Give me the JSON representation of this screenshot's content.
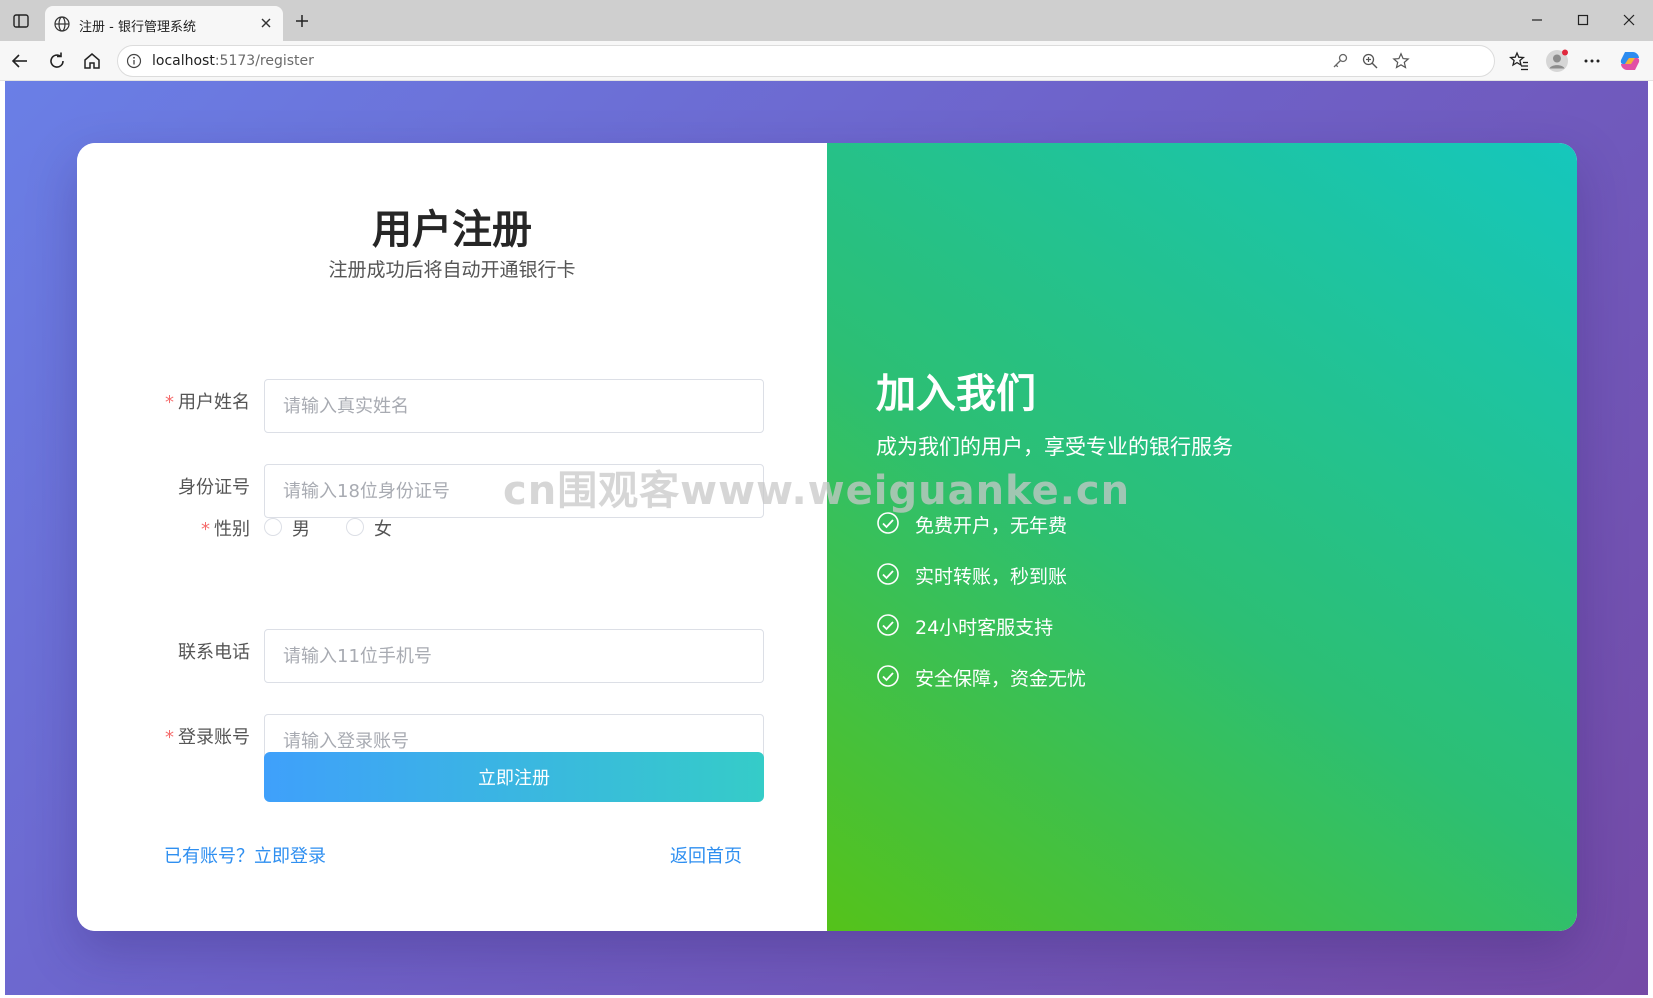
{
  "browser": {
    "tab_title": "注册 - 银行管理系统",
    "url_host": "localhost",
    "url_rest": ":5173/register"
  },
  "form": {
    "title": "用户注册",
    "subtitle": "注册成功后将自动开通银行卡",
    "required_mark": "*",
    "name_label": "用户姓名",
    "name_placeholder": "请输入真实姓名",
    "name_value": "",
    "id_label": "身份证号",
    "id_placeholder": "请输入18位身份证号",
    "id_value": "",
    "gender_label": "性别",
    "gender_options": [
      "男",
      "女"
    ],
    "phone_label": "联系电话",
    "phone_placeholder": "请输入11位手机号",
    "phone_value": "",
    "account_label": "登录账号",
    "account_placeholder": "请输入登录账号",
    "account_value": "",
    "submit_label": "立即注册",
    "login_link": "已有账号？立即登录",
    "home_link": "返回首页"
  },
  "promo": {
    "title": "加入我们",
    "subtitle": "成为我们的用户，享受专业的银行服务",
    "features": [
      "免费开户，无年费",
      "实时转账，秒到账",
      "24小时客服支持",
      "安全保障，资金无忧"
    ]
  },
  "watermark": "cn围观客www.weiguanke.cn",
  "colors": {
    "background_start": "#6a7fe6",
    "background_end": "#744aa6",
    "promo_start": "#55c21a",
    "promo_end": "#15c7bd",
    "button_start": "#3fa0fb",
    "button_end": "#35ccc8",
    "link": "#2f8ff0",
    "required": "#f56c6c"
  },
  "icons": [
    "sidebar-icon",
    "globe-icon",
    "close-icon",
    "plus-icon",
    "minimize-icon",
    "maximize-icon",
    "back-icon",
    "reload-icon",
    "home-icon",
    "info-icon",
    "key-icon",
    "zoom-icon",
    "star-icon",
    "favorites-icon",
    "profile-icon",
    "more-icon",
    "copilot-icon",
    "check-circle-icon"
  ]
}
